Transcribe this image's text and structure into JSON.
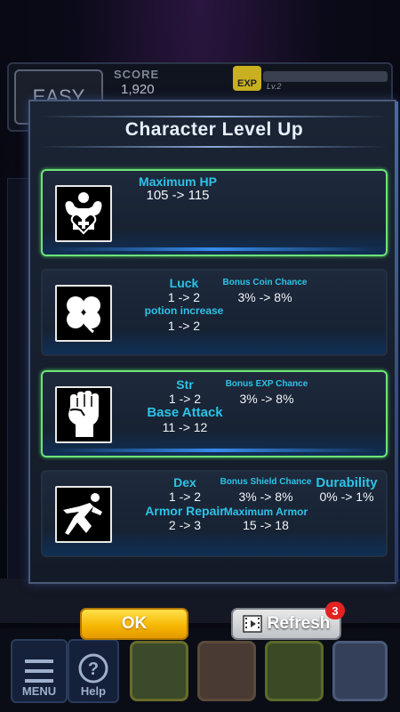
{
  "hud": {
    "difficulty": "EASY",
    "score_label": "SCORE",
    "score_value": "1,920",
    "exp_label": "EXP",
    "level": "Lv.2"
  },
  "modal": {
    "title": "Character Level Up",
    "cards": [
      {
        "icon": "heart-muscle-icon",
        "stat_name": "Maximum HP",
        "stat_change": "105 -> 115"
      },
      {
        "icon": "clover-icon",
        "stat_name": "Luck",
        "stat_change": "1 -> 2",
        "sub_name": "potion increase",
        "sub_change": "1 -> 2",
        "bonus_name": "Bonus Coin Chance",
        "bonus_change": "3% -> 8%"
      },
      {
        "icon": "fist-icon",
        "stat_name": "Str",
        "stat_change": "1 -> 2",
        "sub_name": "Base Attack",
        "sub_change": "11 -> 12",
        "bonus_name": "Bonus EXP Chance",
        "bonus_change": "3% -> 8%"
      },
      {
        "icon": "running-figure-icon",
        "stat_name": "Dex",
        "stat_change": "1 -> 2",
        "sub_name": "Armor Repair",
        "sub_change": "2 -> 3",
        "bonus_name": "Bonus Shield Chance",
        "bonus_change": "3% -> 8%",
        "bonus2_name": "Maximum Armor",
        "bonus2_change": "15 -> 18",
        "extra_name": "Durability",
        "extra_change": "0% -> 1%"
      }
    ]
  },
  "buttons": {
    "ok_label": "OK",
    "refresh_label": "Refresh",
    "refresh_badge": "3"
  },
  "bottom_bar": {
    "menu_label": "MENU",
    "help_label": "Help"
  },
  "colors": {
    "accent_cyan": "#2bc3e8",
    "selected_border": "#6ee37a",
    "ok_yellow": "#f5b400",
    "badge_red": "#e32222"
  }
}
